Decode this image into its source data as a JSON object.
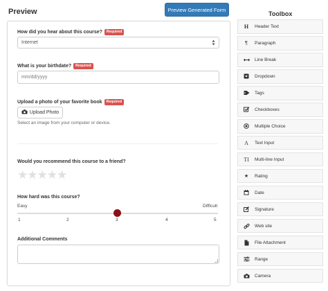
{
  "header": {
    "preview_title": "Preview",
    "preview_button": "Preview Generated Form",
    "toolbox_title": "Toolbox"
  },
  "form": {
    "q1": {
      "label": "How did you hear about this course?",
      "required": "Required",
      "value": "Internet"
    },
    "q2": {
      "label": "What is your birthdate?",
      "required": "Required",
      "placeholder": "mm/dd/yyyy"
    },
    "q3": {
      "label": "Upload a photo of your favorite book",
      "required": "Required",
      "button": "Upload Photo",
      "help": "Select an image from your computer or device."
    },
    "q4": {
      "label": "Would you recommend this course to a friend?",
      "stars_total": 5,
      "stars_filled": 0
    },
    "q5": {
      "label": "How hard was this course?",
      "min_label": "Easy",
      "max_label": "Difficult",
      "ticks": [
        "1",
        "2",
        "3",
        "4",
        "5"
      ],
      "value": 3
    },
    "q6": {
      "label": "Additional Comments"
    }
  },
  "toolbox": {
    "items": [
      {
        "label": "Header Text",
        "icon": "header-icon"
      },
      {
        "label": "Paragraph",
        "icon": "paragraph-icon"
      },
      {
        "label": "Line Break",
        "icon": "line-break-icon"
      },
      {
        "label": "Dropdown",
        "icon": "dropdown-icon"
      },
      {
        "label": "Tags",
        "icon": "tags-icon"
      },
      {
        "label": "Checkboxes",
        "icon": "checkboxes-icon"
      },
      {
        "label": "Multiple Choice",
        "icon": "multiple-choice-icon"
      },
      {
        "label": "Text Input",
        "icon": "text-input-icon"
      },
      {
        "label": "Multi-line Input",
        "icon": "multi-line-input-icon"
      },
      {
        "label": "Rating",
        "icon": "rating-icon"
      },
      {
        "label": "Date",
        "icon": "date-icon"
      },
      {
        "label": "Signature",
        "icon": "signature-icon"
      },
      {
        "label": "Web site",
        "icon": "web-site-icon"
      },
      {
        "label": "File Attachment",
        "icon": "file-attachment-icon"
      },
      {
        "label": "Range",
        "icon": "range-icon"
      },
      {
        "label": "Camera",
        "icon": "camera-icon"
      }
    ]
  }
}
